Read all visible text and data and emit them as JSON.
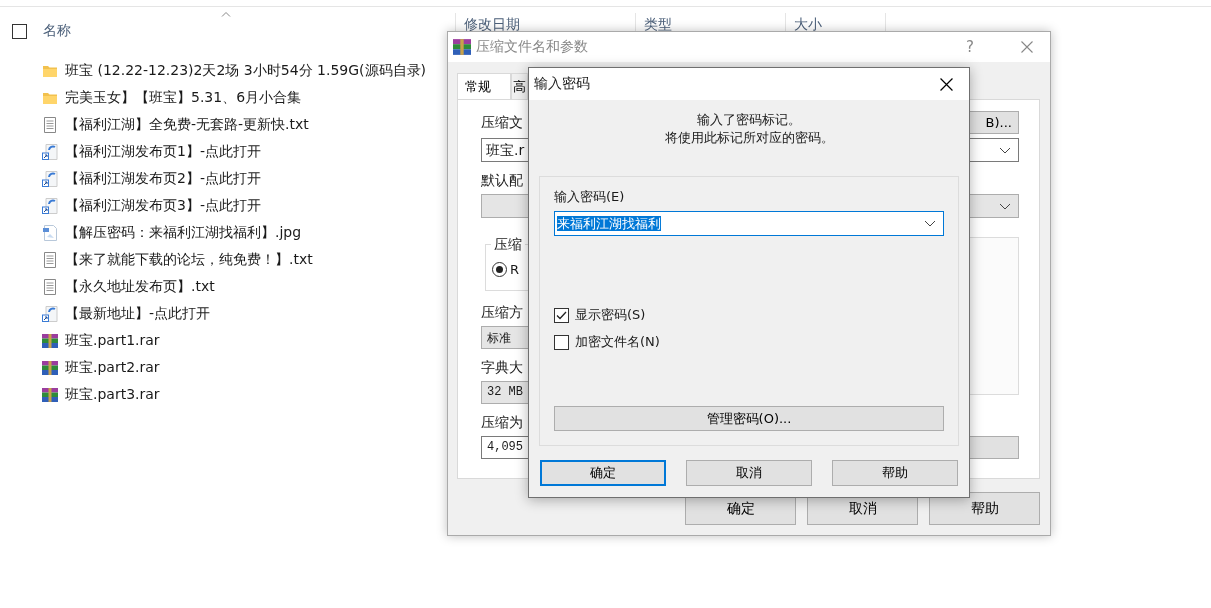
{
  "explorer": {
    "select_all_checked": false,
    "columns": [
      {
        "label": "名称",
        "sorted": true
      },
      {
        "label": "修改日期",
        "sorted": false
      },
      {
        "label": "类型",
        "sorted": false
      },
      {
        "label": "大小",
        "sorted": false
      }
    ],
    "files": [
      {
        "name": "班宝 (12.22-12.23)2天2场 3小时54分 1.59G(源码自录)",
        "kind": "folder"
      },
      {
        "name": "完美玉女】【班宝】5.31、6月小合集",
        "kind": "folder"
      },
      {
        "name": "【福利江湖】全免费-无套路-更新快.txt",
        "kind": "text"
      },
      {
        "name": "【福利江湖发布页1】-点此打开",
        "kind": "shortcut"
      },
      {
        "name": "【福利江湖发布页2】-点此打开",
        "kind": "shortcut"
      },
      {
        "name": "【福利江湖发布页3】-点此打开",
        "kind": "shortcut"
      },
      {
        "name": "【解压密码：来福利江湖找福利】.jpg",
        "kind": "image"
      },
      {
        "name": "【来了就能下载的论坛，纯免费！】.txt",
        "kind": "text"
      },
      {
        "name": "【永久地址发布页】.txt",
        "kind": "text"
      },
      {
        "name": "【最新地址】-点此打开",
        "kind": "shortcut"
      },
      {
        "name": "班宝.part1.rar",
        "kind": "archive"
      },
      {
        "name": "班宝.part2.rar",
        "kind": "archive"
      },
      {
        "name": "班宝.part3.rar",
        "kind": "archive"
      }
    ]
  },
  "archive_dialog": {
    "title": "压缩文件名和参数",
    "active": false,
    "help_button": "?",
    "tabs": [
      {
        "label": "常规",
        "selected": true
      },
      {
        "label": "高",
        "selected": false
      }
    ],
    "archive_name_label": "压缩文",
    "browse_button": "B)...",
    "archive_name_value": "班宝.r",
    "profile_label": "默认配",
    "format_group_label": "压缩",
    "format_option": {
      "label": "R",
      "selected": true
    },
    "method_label": "压缩方",
    "method_value": "标准",
    "dictionary_label": "字典大",
    "dictionary_value": "32 MB",
    "split_label": "压缩为",
    "split_value": "4,095",
    "buttons": [
      "确定",
      "取消",
      "帮助"
    ]
  },
  "password_dialog": {
    "title": "输入密码",
    "active": true,
    "message": [
      "输入了密码标记。",
      "将使用此标记所对应的密码。"
    ],
    "password_label": "输入密码(E)",
    "password_value": "来福利江湖找福利",
    "options": [
      {
        "label": "显示密码(S)",
        "checked": true
      },
      {
        "label": "加密文件名(N)",
        "checked": false
      }
    ],
    "manage_button": "管理密码(O)...",
    "buttons": [
      {
        "label": "确定",
        "default": true
      },
      {
        "label": "取消",
        "default": false
      },
      {
        "label": "帮助",
        "default": false
      }
    ]
  }
}
